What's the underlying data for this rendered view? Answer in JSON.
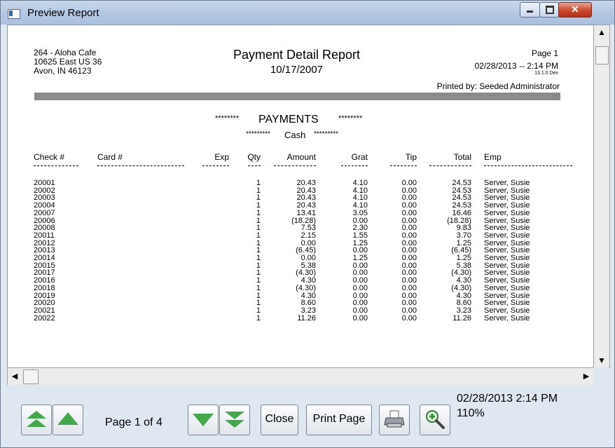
{
  "window": {
    "title": "Preview Report"
  },
  "report": {
    "store": [
      "264 - Aloha Cafe",
      "10625 East US 36",
      "Avon, IN 46123"
    ],
    "title": "Payment Detail Report",
    "date": "10/17/2007",
    "page": "Page 1",
    "printed_datetime": "02/28/2013 --   2:14 PM",
    "version": "13.1.0 Dev",
    "printed_by": "Printed by: Seeded Administrator",
    "section_left_stars": "********",
    "section_title": "PAYMENTS",
    "section_right_stars": "********",
    "sub_left_stars": "*********",
    "sub_title": "Cash",
    "sub_right_stars": "*********",
    "columns": [
      "Check #",
      "Card #",
      "Exp",
      "Qty",
      "Amount",
      "Grat",
      "Tip",
      "Total",
      "Emp"
    ],
    "rows": [
      [
        "20001",
        "",
        "",
        "1",
        "20.43",
        "4.10",
        "0.00",
        "24.53",
        "Server, Susie"
      ],
      [
        "20002",
        "",
        "",
        "1",
        "20.43",
        "4.10",
        "0.00",
        "24.53",
        "Server, Susie"
      ],
      [
        "20003",
        "",
        "",
        "1",
        "20.43",
        "4.10",
        "0.00",
        "24.53",
        "Server, Susie"
      ],
      [
        "20004",
        "",
        "",
        "1",
        "20.43",
        "4.10",
        "0.00",
        "24.53",
        "Server, Susie"
      ],
      [
        "20007",
        "",
        "",
        "1",
        "13.41",
        "3.05",
        "0.00",
        "16.46",
        "Server, Susie"
      ],
      [
        "20006",
        "",
        "",
        "1",
        "(18.28)",
        "0.00",
        "0.00",
        "(18.28)",
        "Server, Susie"
      ],
      [
        "20008",
        "",
        "",
        "1",
        "7.53",
        "2.30",
        "0.00",
        "9.83",
        "Server, Susie"
      ],
      [
        "20011",
        "",
        "",
        "1",
        "2.15",
        "1.55",
        "0.00",
        "3.70",
        "Server, Susie"
      ],
      [
        "20012",
        "",
        "",
        "1",
        "0.00",
        "1.25",
        "0.00",
        "1.25",
        "Server, Susie"
      ],
      [
        "20013",
        "",
        "",
        "1",
        "(6.45)",
        "0.00",
        "0.00",
        "(6.45)",
        "Server, Susie"
      ],
      [
        "20014",
        "",
        "",
        "1",
        "0.00",
        "1.25",
        "0.00",
        "1.25",
        "Server, Susie"
      ],
      [
        "20015",
        "",
        "",
        "1",
        "5.38",
        "0.00",
        "0.00",
        "5.38",
        "Server, Susie"
      ],
      [
        "20017",
        "",
        "",
        "1",
        "(4.30)",
        "0.00",
        "0.00",
        "(4.30)",
        "Server, Susie"
      ],
      [
        "20016",
        "",
        "",
        "1",
        "4.30",
        "0.00",
        "0.00",
        "4.30",
        "Server, Susie"
      ],
      [
        "20018",
        "",
        "",
        "1",
        "(4.30)",
        "0.00",
        "0.00",
        "(4.30)",
        "Server, Susie"
      ],
      [
        "20019",
        "",
        "",
        "1",
        "4.30",
        "0.00",
        "0.00",
        "4.30",
        "Server, Susie"
      ],
      [
        "20020",
        "",
        "",
        "1",
        "8.60",
        "0.00",
        "0.00",
        "8.60",
        "Server, Susie"
      ],
      [
        "20021",
        "",
        "",
        "1",
        "3.23",
        "0.00",
        "0.00",
        "3.23",
        "Server, Susie"
      ],
      [
        "20022",
        "",
        "",
        "1",
        "11.26",
        "0.00",
        "0.00",
        "11.26",
        "Server, Susie"
      ]
    ]
  },
  "toolbar": {
    "page_label": "Page 1 of 4",
    "close_label": "Close",
    "print_page_label": "Print Page",
    "datetime": "02/28/2013  2:14 PM",
    "zoom": "110%"
  },
  "icons": {
    "first": "double-up-arrow-icon",
    "prev": "up-arrow-icon",
    "next": "down-arrow-icon",
    "last": "double-down-arrow-icon",
    "printer": "printer-icon",
    "zoom": "zoom-in-icon"
  },
  "colors": {
    "arrow_green": "#43a84a",
    "window_bg": "#dfe7f1",
    "band_gray": "#8b8b8b"
  }
}
